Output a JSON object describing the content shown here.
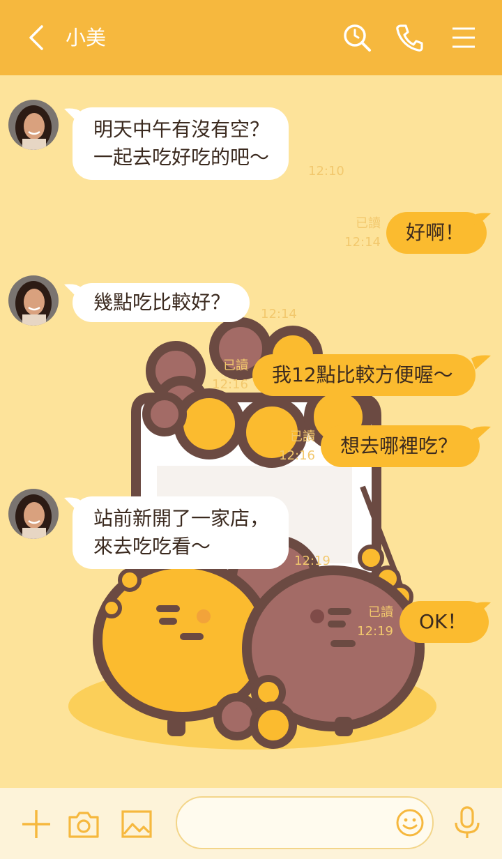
{
  "header": {
    "title": "小美",
    "icons": [
      "chevron-left-icon",
      "search-icon",
      "phone-icon",
      "menu-icon"
    ]
  },
  "messages": [
    {
      "side": "in",
      "lines": [
        "明天中午有沒有空？",
        "一起去吃好吃的吧～"
      ],
      "time": "12:10"
    },
    {
      "side": "out",
      "text": "好啊！",
      "read": "已讀",
      "time": "12:14"
    },
    {
      "side": "in",
      "text": "幾點吃比較好？",
      "time": "12:14"
    },
    {
      "side": "out",
      "text": "我12點比較方便喔～",
      "read": "已讀",
      "time": "12:16"
    },
    {
      "side": "out",
      "text": "想去哪裡吃？",
      "read": "已讀",
      "time": "12:16"
    },
    {
      "side": "in",
      "lines": [
        "站前新開了一家店，",
        "來去吃吃看～"
      ],
      "time": "12:19"
    },
    {
      "side": "out",
      "text": "OK！",
      "read": "已讀",
      "time": "12:19"
    }
  ],
  "footer": {
    "icons": [
      "plus-icon",
      "camera-icon",
      "image-icon",
      "emoji-icon",
      "microphone-icon"
    ],
    "input_value": ""
  },
  "colors": {
    "header": "#f6b83e",
    "chat_background": "#fde39a",
    "incoming_bubble": "#ffffff",
    "outgoing_bubble": "#fbbb2f",
    "footer": "#fdf3d9"
  }
}
